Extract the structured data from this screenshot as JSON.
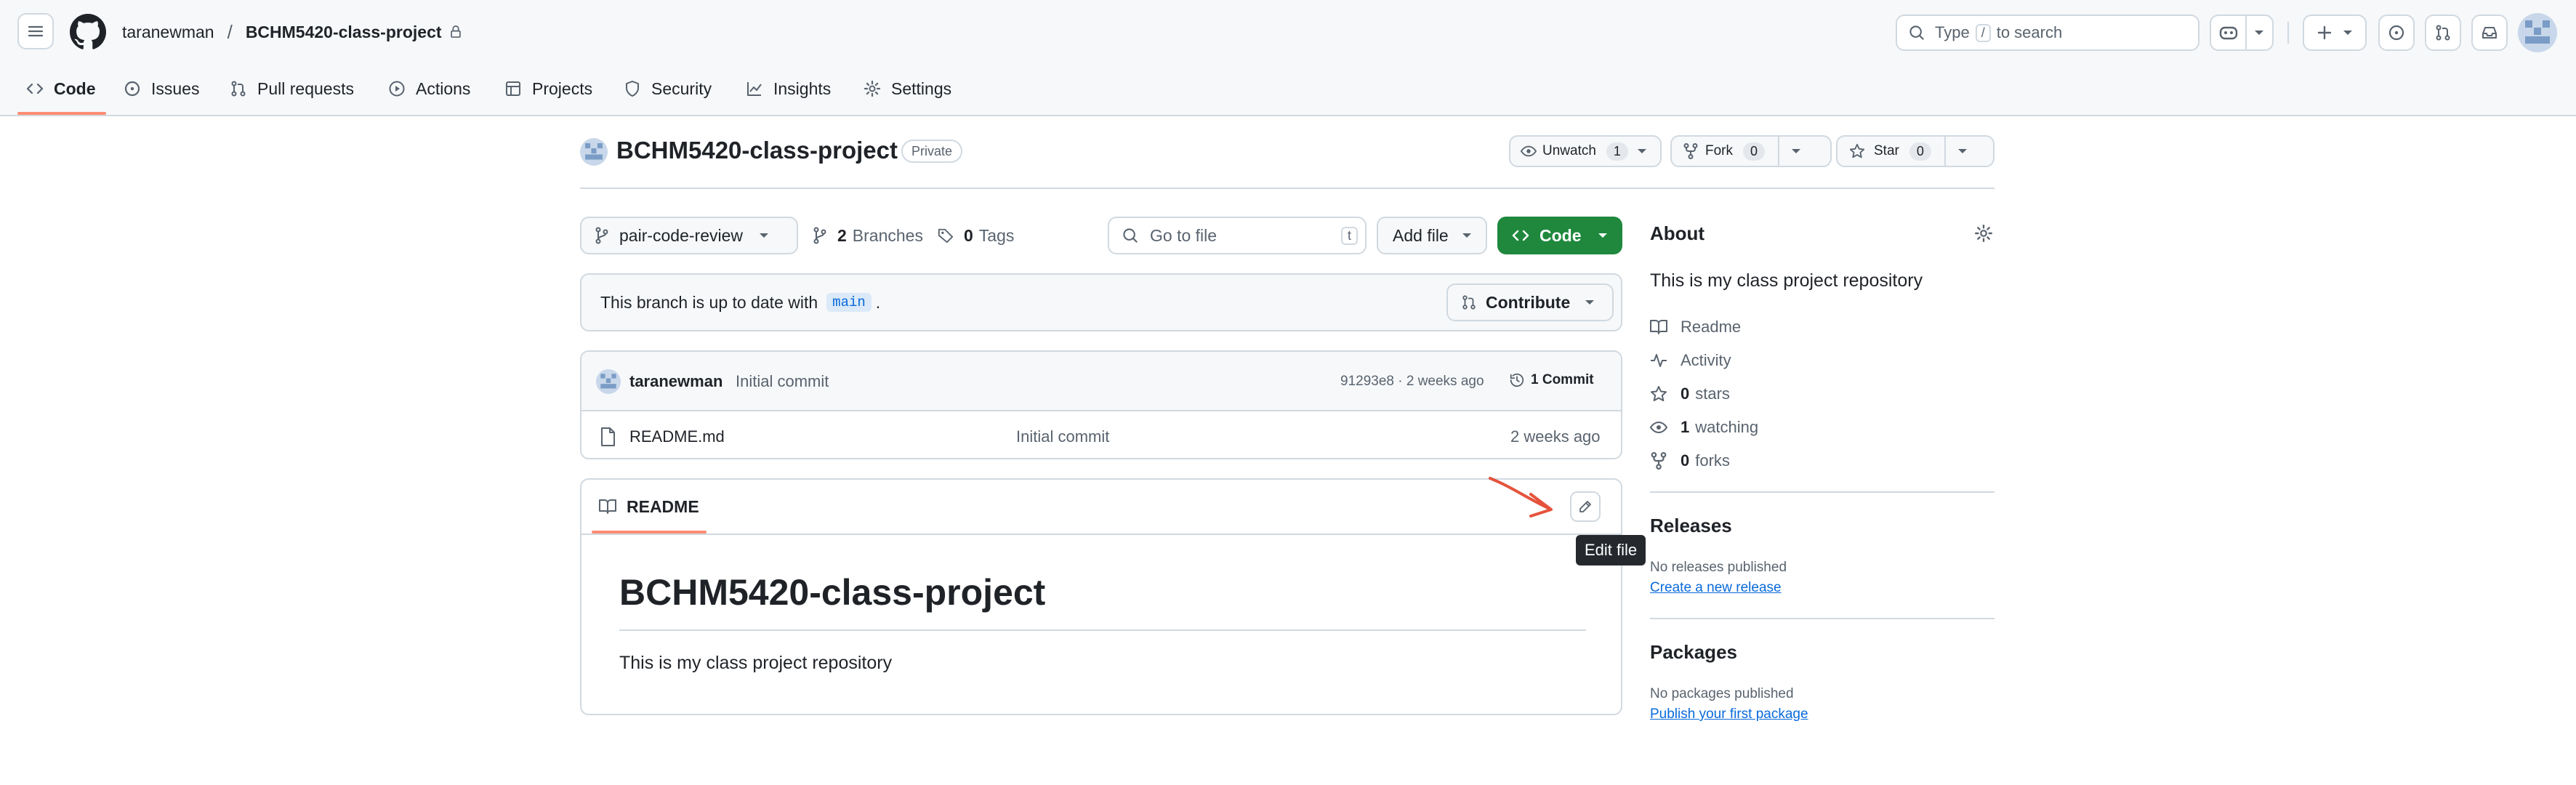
{
  "header": {
    "owner": "taranewman",
    "separator": "/",
    "repo": "BCHM5420-class-project",
    "search_prefix": "Type",
    "search_key": "/",
    "search_suffix": "to search"
  },
  "nav": {
    "tabs": [
      {
        "label": "Code",
        "icon": "code-icon"
      },
      {
        "label": "Issues",
        "icon": "issues-icon"
      },
      {
        "label": "Pull requests",
        "icon": "pull-request-icon"
      },
      {
        "label": "Actions",
        "icon": "play-icon"
      },
      {
        "label": "Projects",
        "icon": "table-icon"
      },
      {
        "label": "Security",
        "icon": "shield-icon"
      },
      {
        "label": "Insights",
        "icon": "graph-icon"
      },
      {
        "label": "Settings",
        "icon": "gear-icon"
      }
    ],
    "active": "Code"
  },
  "repo": {
    "name": "BCHM5420-class-project",
    "visibility": "Private",
    "unwatch_label": "Unwatch",
    "unwatch_count": "1",
    "fork_label": "Fork",
    "fork_count": "0",
    "star_label": "Star",
    "star_count": "0"
  },
  "toolbar": {
    "branch": "pair-code-review",
    "branches_count": "2",
    "branches_label": "Branches",
    "tags_count": "0",
    "tags_label": "Tags",
    "goto_placeholder": "Go to file",
    "goto_key": "t",
    "add_file_label": "Add file",
    "code_label": "Code"
  },
  "branch_status": {
    "text": "This branch is up to date with",
    "branch": "main",
    "period": ".",
    "contribute_label": "Contribute"
  },
  "commit": {
    "author": "taranewman",
    "message": "Initial commit",
    "hash_time": "91293e8 · 2 weeks ago",
    "commits_label": "1 Commit"
  },
  "files": [
    {
      "name": "README.md",
      "message": "Initial commit",
      "time": "2 weeks ago"
    }
  ],
  "readme": {
    "tab_label": "README",
    "tooltip": "Edit file",
    "heading": "BCHM5420-class-project",
    "body": "This is my class project repository"
  },
  "about": {
    "title": "About",
    "description": "This is my class project repository",
    "readme": "Readme",
    "activity": "Activity",
    "stars_count": "0",
    "stars_label": "stars",
    "watching_count": "1",
    "watching_label": "watching",
    "forks_count": "0",
    "forks_label": "forks"
  },
  "releases": {
    "title": "Releases",
    "none": "No releases published",
    "link": "Create a new release"
  },
  "packages": {
    "title": "Packages",
    "none": "No packages published",
    "link": "Publish your first package"
  },
  "colors": {
    "accent": "#0969da",
    "primary_button": "#1f883d",
    "active_tab_underline": "#fd8c73",
    "annotation_arrow": "#e5533c"
  }
}
